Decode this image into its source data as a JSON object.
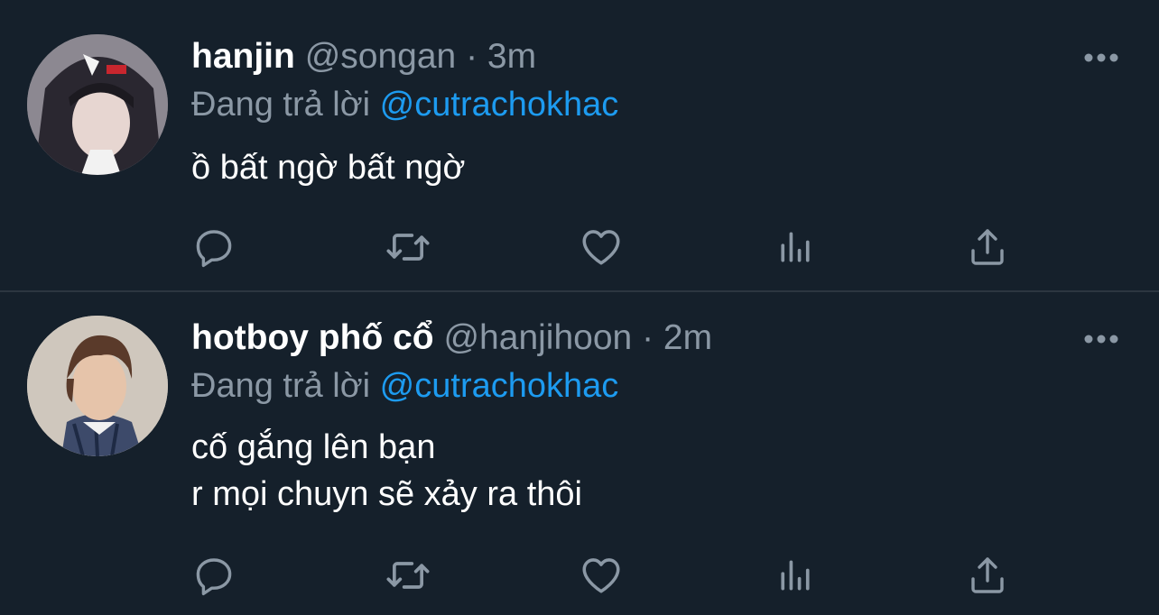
{
  "tweets": [
    {
      "display_name": "hanjin",
      "handle": "@songan",
      "separator": "·",
      "time": "3m",
      "reply_prefix": "Đang trả lời",
      "reply_to": "@cutrachokhac",
      "body_lines": [
        "ồ bất ngờ bất ngờ"
      ]
    },
    {
      "display_name": "hotboy phố cổ",
      "handle": "@hanjihoon",
      "separator": "·",
      "time": "2m",
      "reply_prefix": "Đang trả lời",
      "reply_to": "@cutrachokhac",
      "body_lines": [
        "cố gắng lên bạn",
        "r mọi chuyn sẽ xảy ra thôi"
      ]
    }
  ],
  "icons": {
    "more": "more-horizontal-icon",
    "reply": "reply-icon",
    "retweet": "retweet-icon",
    "like": "heart-icon",
    "stats": "analytics-icon",
    "share": "share-icon"
  },
  "colors": {
    "background": "#15202b",
    "text": "#ffffff",
    "secondary": "#8b98a5",
    "mention": "#1d9bf0"
  }
}
